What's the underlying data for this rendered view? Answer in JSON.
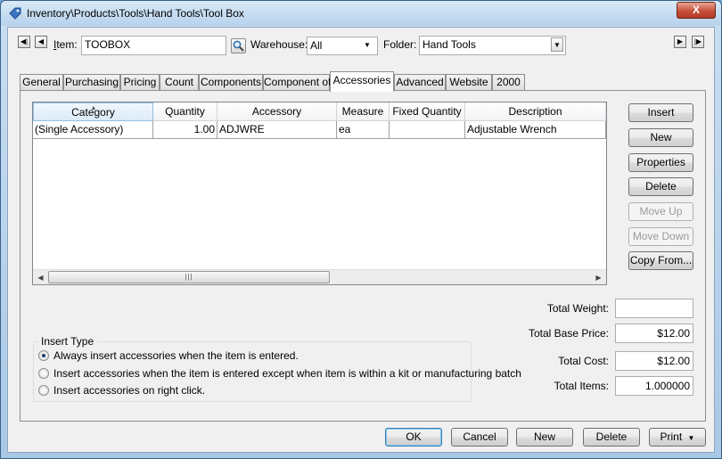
{
  "window": {
    "title": "Inventory\\Products\\Tools\\Hand Tools\\Tool Box",
    "close_label": "X"
  },
  "header": {
    "first_label": "◀|",
    "prev_label": "◀",
    "next_label": "▶",
    "last_label": "|▶",
    "item_label_accel": "I",
    "item_label_rest": "tem:",
    "item_value": "TOOBOX",
    "warehouse_label": "Warehouse:",
    "warehouse_value": "All",
    "folder_label": "Folder:",
    "folder_value": "Hand Tools"
  },
  "tabs": [
    {
      "label": "General"
    },
    {
      "label": "Purchasing"
    },
    {
      "label": "Pricing"
    },
    {
      "label": "Count"
    },
    {
      "label": "Components"
    },
    {
      "label": "Component of"
    },
    {
      "label": "Accessories"
    },
    {
      "label": "Advanced"
    },
    {
      "label": "Website"
    },
    {
      "label": "2000"
    }
  ],
  "active_tab": "Accessories",
  "grid": {
    "columns": [
      "Category",
      "Quantity",
      "Accessory",
      "Measure",
      "Fixed Quantity",
      "Description"
    ],
    "rows": [
      [
        "(Single Accessory)",
        "1.00",
        "ADJWRE",
        "ea",
        "",
        "Adjustable Wrench"
      ]
    ],
    "scroll_thumb": "|||"
  },
  "side_buttons": {
    "insert": "Insert",
    "new": "New",
    "properties": "Properties",
    "delete": "Delete",
    "move_up": "Move Up",
    "move_down": "Move Down",
    "copy_from": "Copy From..."
  },
  "insert_type": {
    "legend": "Insert Type",
    "options": [
      {
        "label": "Always insert accessories when the item is entered.",
        "checked": true
      },
      {
        "label": "Insert accessories when the item is entered except when item is within a kit or manufacturing batch",
        "checked": false
      },
      {
        "label": "Insert accessories on right click.",
        "checked": false
      }
    ]
  },
  "totals": {
    "weight_label": "Total Weight:",
    "weight_value": "",
    "base_price_label": "Total Base Price:",
    "base_price_value": "$12.00",
    "cost_label": "Total Cost:",
    "cost_value": "$12.00",
    "items_label": "Total Items:",
    "items_value": "1.000000"
  },
  "footer": {
    "ok": "OK",
    "cancel": "Cancel",
    "new": "New",
    "delete": "Delete",
    "print": "Print"
  }
}
